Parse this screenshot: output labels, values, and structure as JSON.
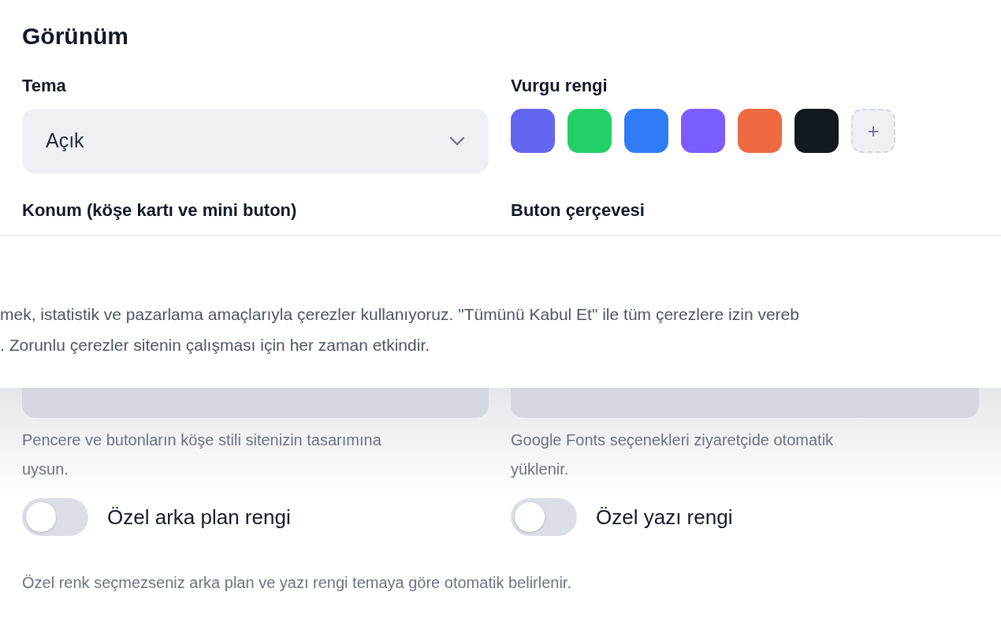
{
  "section_title": "Görünüm",
  "top_fields": [
    {
      "label": "Tema",
      "kind": "select",
      "value": "Açık"
    },
    {
      "label": "Vurgu rengi",
      "kind": "swatches",
      "swatches": [
        {
          "color": "#6366f1"
        },
        {
          "color": "#22d066"
        },
        {
          "color": "#2f7cf6"
        },
        {
          "color": "#7b5cff"
        },
        {
          "color": "#ef6a40"
        },
        {
          "color": "#121a1f"
        }
      ],
      "add_button": "+"
    }
  ],
  "middle_labels": [
    "Konum (köşe kartı ve mini buton)",
    "Buton çerçevesi"
  ],
  "lower_fields": [
    {
      "help": "Pencere ve butonların köşe stili sitenizin tasarımına uysun."
    },
    {
      "help": "Google Fonts seçenekleri ziyaretçide otomatik yüklenir."
    }
  ],
  "toggles": [
    {
      "label": "Özel arka plan rengi",
      "on": false
    },
    {
      "label": "Özel yazı rengi",
      "on": false
    }
  ],
  "note": "Özel renk seçmezseniz arka plan ve yazı rengi temaya göre otomatik belirlenir.",
  "cookie_banner": {
    "lines": [
      "mek, istatistik ve pazarlama amaçlarıyla çerezler kullanıyoruz. \"Tümünü Kabul Et\" ile tüm çerezlere izin vereb",
      ". Zorunlu çerezler sitenin çalışması için her zaman etkindir."
    ]
  }
}
